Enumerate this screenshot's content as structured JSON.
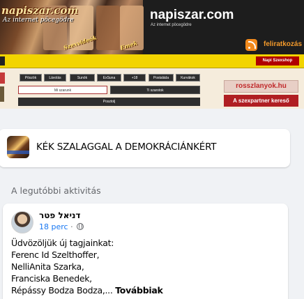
{
  "banner": {
    "logo_text": "napiszar.com",
    "logo_sub": "Az internet pöcegödre",
    "tag_1": "Szexvideók",
    "tag_2": "Emek",
    "title": "napiszar.com",
    "subtitle": "Az internet pöcegödre",
    "subscribe": "feliratkozás",
    "rss_icon": "rss-icon"
  },
  "nav": {
    "items": [
      "Pöszök",
      "Lávolás",
      "Sunók",
      "ExSuna",
      "+18",
      "Postaláda",
      "Kurvákok"
    ],
    "mi_szarunk": "Mi szarunk",
    "ti_szarotok": "Ti szarotok",
    "posztolj": "Posztolj",
    "napi_szexshop": "Napi Szexshop"
  },
  "ads": {
    "rosszlanyok": "rosszlanyok.hu",
    "szexpartner": "A szexpartner kereső"
  },
  "group": {
    "name": "KÉK SZALAGGAL A DEMOKRÁCIÁNKÉRT"
  },
  "activity": {
    "section_title": "A legutóbbi aktivitás",
    "post": {
      "author": "דניאל פטר",
      "time": "18 perc",
      "separator": "·",
      "lines": [
        "Üdvözöljük új tagjainkat:",
        "Ferenc Id Szelthoffer,",
        "NelliAnita Szarka,",
        "Franciska Benedek,",
        "Répássy Bodza Bodza,..."
      ],
      "more_label": "Továbbiak"
    }
  },
  "colors": {
    "accent_blue": "#1877f2",
    "nav_yellow": "#f2d400",
    "rss_orange": "#f28a1d",
    "ad_red": "#b01e22"
  }
}
